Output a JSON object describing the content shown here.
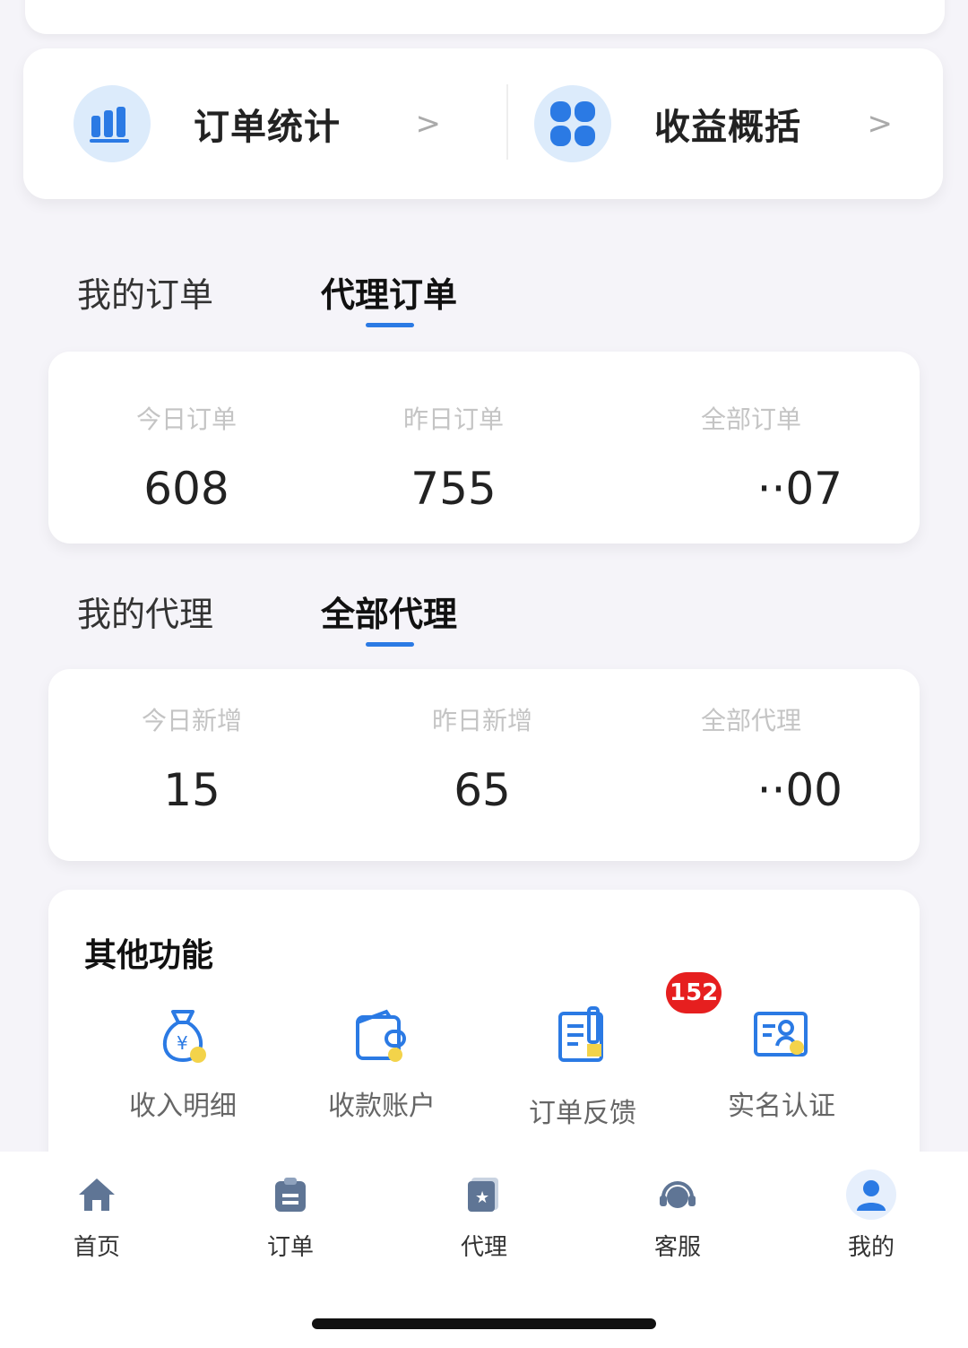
{
  "quick": {
    "order_stats": "订单统计",
    "earnings": "收益概括",
    "arrow": ">"
  },
  "order_tabs": [
    "我的订单",
    "代理订单"
  ],
  "order_stats": [
    {
      "label": "今日订单",
      "value": "608"
    },
    {
      "label": "昨日订单",
      "value": "755"
    },
    {
      "label": "全部订单",
      "value": "··07"
    }
  ],
  "agent_tabs": [
    "我的代理",
    "全部代理"
  ],
  "agent_stats": [
    {
      "label": "今日新增",
      "value": "15"
    },
    {
      "label": "昨日新增",
      "value": "65"
    },
    {
      "label": "全部代理",
      "value": "··00"
    }
  ],
  "functions": {
    "title": "其他功能",
    "items": [
      {
        "label": "收入明细",
        "icon": "money-bag-icon"
      },
      {
        "label": "收款账户",
        "icon": "wallet-icon"
      },
      {
        "label": "订单反馈",
        "icon": "feedback-icon",
        "badge": "152"
      },
      {
        "label": "实名认证",
        "icon": "id-card-icon"
      }
    ]
  },
  "nav": [
    {
      "label": "首页",
      "icon": "home-icon"
    },
    {
      "label": "订单",
      "icon": "clipboard-icon"
    },
    {
      "label": "代理",
      "icon": "agent-icon"
    },
    {
      "label": "客服",
      "icon": "headset-icon"
    },
    {
      "label": "我的",
      "icon": "user-icon"
    }
  ],
  "colors": {
    "accent": "#2b7ae4",
    "badge": "#e61f1f",
    "icon_bg": "#dcebfb"
  }
}
